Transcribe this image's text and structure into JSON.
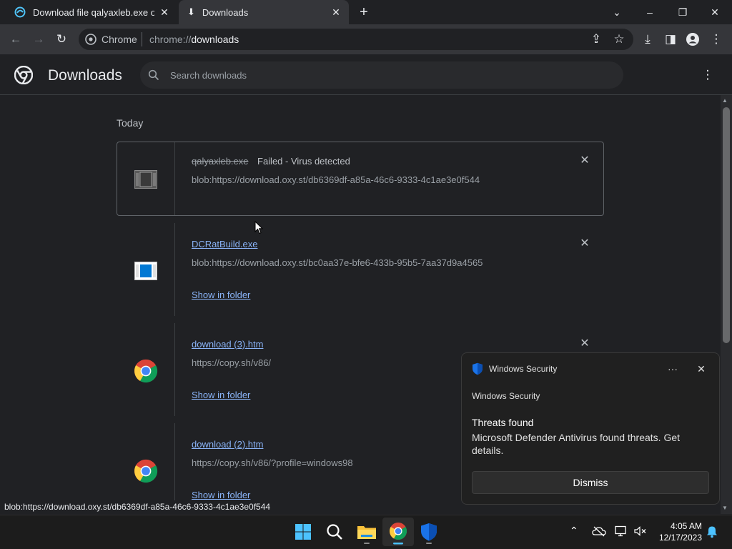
{
  "browser": {
    "tabs": [
      {
        "title": "Download file qalyaxleb.exe on O"
      },
      {
        "title": "Downloads"
      }
    ],
    "omnibox": {
      "site_label": "Chrome",
      "url_prefix": "chrome://",
      "url_host": "downloads"
    }
  },
  "downloads_page": {
    "title": "Downloads",
    "search_placeholder": "Search downloads",
    "section_label": "Today",
    "items": [
      {
        "filename": "qalyaxleb.exe",
        "status": "Failed - Virus detected",
        "url": "blob:https://download.oxy.st/db6369df-a85a-46c6-9333-4c1ae3e0f544"
      },
      {
        "filename": "DCRatBuild.exe",
        "url": "blob:https://download.oxy.st/bc0aa37e-bfe6-433b-95b5-7aa37d9a4565",
        "action": "Show in folder"
      },
      {
        "filename": "download (3).htm",
        "url": "https://copy.sh/v86/",
        "action": "Show in folder"
      },
      {
        "filename": "download (2).htm",
        "url": "https://copy.sh/v86/?profile=windows98",
        "action": "Show in folder"
      }
    ]
  },
  "status_bubble": "blob:https://download.oxy.st/db6369df-a85a-46c6-9333-4c1ae3e0f544",
  "toast": {
    "app_name": "Windows Security",
    "subtitle": "Windows Security",
    "heading": "Threats found",
    "body": "Microsoft Defender Antivirus found threats. Get details.",
    "dismiss_label": "Dismiss"
  },
  "taskbar": {
    "time": "4:05 AM",
    "date": "12/17/2023"
  },
  "colors": {
    "link": "#8ab4f8",
    "background": "#202124",
    "toolbar": "#35363a"
  }
}
